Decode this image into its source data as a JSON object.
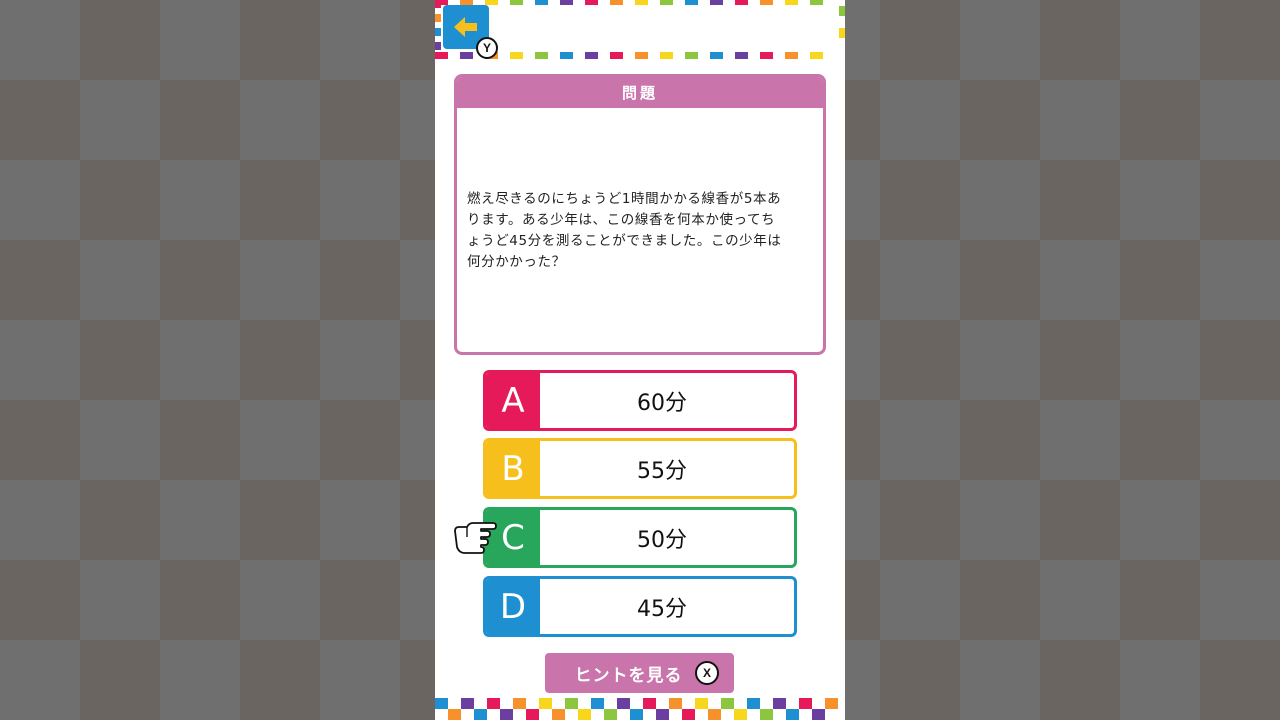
{
  "colors": {
    "pink": "#c975ac",
    "a": "#e6195a",
    "b": "#f7bf1b",
    "c": "#27a65c",
    "d": "#1e8fd1",
    "back": "#1e8fd1",
    "arrow": "#f7bf1b"
  },
  "header": {
    "back_icon": "arrow-left-icon",
    "back_shortcut": "Y"
  },
  "question": {
    "title": "問題",
    "lines": [
      "燃え尽きるのにちょうど1時間かかる線香が5本あ",
      "ります。ある少年は、この線香を何本か使ってち",
      "ょうど45分を測ることができました。この少年は",
      "何分かかった？"
    ]
  },
  "answers": [
    {
      "letter": "A",
      "text": "60分"
    },
    {
      "letter": "B",
      "text": "55分"
    },
    {
      "letter": "C",
      "text": "50分"
    },
    {
      "letter": "D",
      "text": "45分"
    }
  ],
  "pointer": {
    "icon": "pointing-hand-icon",
    "selected": "C"
  },
  "hint": {
    "label": "ヒントを見る",
    "shortcut": "X"
  }
}
